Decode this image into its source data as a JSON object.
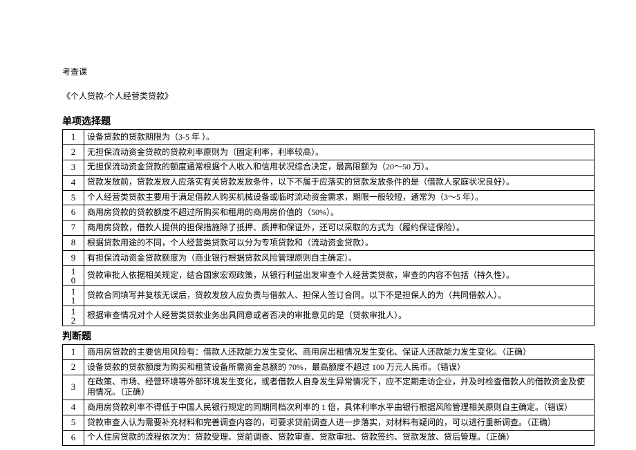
{
  "header": {
    "course_label": "考查课",
    "title": "《个人贷款-个人经营类贷款》"
  },
  "section1": {
    "title": "单项选择题",
    "items": [
      {
        "n": "1",
        "text": "设备贷款的贷款期限为（3-5 年 ）。"
      },
      {
        "n": "2",
        "text": "无担保流动资金贷款的贷款利率原则为（固定利率，利率较高）。"
      },
      {
        "n": "3",
        "text": "无担保流动资金贷款的额度通常根据个人收入和信用状况综合决定，最高限额为（20～50 万）。"
      },
      {
        "n": "4",
        "text": "贷款发放前，贷款发放人应落实有关贷款发放条件，以下不属于应落实的贷款发放条件的是（借款人家庭状况良好）。"
      },
      {
        "n": "5",
        "text": "个人经营类贷款主要用于满足借款人购买机械设备或临时流动资金需求，期限一般较短，通常为（3～5 年）。"
      },
      {
        "n": "6",
        "text": "商用房贷款的贷款额度不超过所购买和租用的商用房价值的（50%）。"
      },
      {
        "n": "7",
        "text": "商用房贷款，借款人提供的担保措施除了抵押、质押和保证外，还可以采取的方式为（履约保证保险）。"
      },
      {
        "n": "8",
        "text": "根据贷款用途的不同，个人经营类贷款可以分为专项贷款和（流动资金贷款）。"
      },
      {
        "n": "9",
        "text": "有担保流动资金贷款额度为（商业银行根据贷款风险管理原则自主确定）。"
      },
      {
        "n": "10",
        "text": "贷款审批人依据相关规定，结合国家宏观政策，从银行利益出发审查个人经营类贷款，审查的内容不包括（持久性）。"
      },
      {
        "n": "11",
        "text": "贷款合同填写并复核无误后，贷款发放人应负责与借款人、担保人签订合同。以下不是担保人的为（共同借款人）。"
      },
      {
        "n": "12",
        "text": "根据审查情况对个人经营类贷款业务出具同意或者否决的审批意见的是（贷款审批人）。"
      }
    ]
  },
  "section2": {
    "title": "判断题",
    "items": [
      {
        "n": "1",
        "text": "商用房贷款的主要信用风险有：借款人还款能力发生变化、商用房出租情况发生变化、保证人还款能力发生变化。（正确）"
      },
      {
        "n": "2",
        "text": "设备贷款的贷款额度为购买和租赁设备所需资金总额的 70%，最高额度不超过 100 万元人民币。（错误）"
      },
      {
        "n": "3",
        "text": "在政策、市场、经营环境等外部环境发生变化，或者借款人自身发生异常情况下，应不定期走访企业，并及时检查借款人的借款资金及使用情况。（正确）"
      },
      {
        "n": "4",
        "text": "商用房贷款利率不得低于中国人民银行规定的同期同档次利率的 1 倍，具体利率水平由银行根据风险管理相关原则自主确定。（错误）"
      },
      {
        "n": "5",
        "text": "贷款审查人认为需要补充材料和完善调查内容的，可要求贷前调查人进一步落实，对材料有疑问的，可以进行重新调查。（正确）"
      },
      {
        "n": "6",
        "text": "个人住房贷款的流程依次为：贷款受理、贷前调查、贷款审查、贷款审批、贷款签约、贷款发放、贷后管理。（正确）"
      }
    ]
  }
}
